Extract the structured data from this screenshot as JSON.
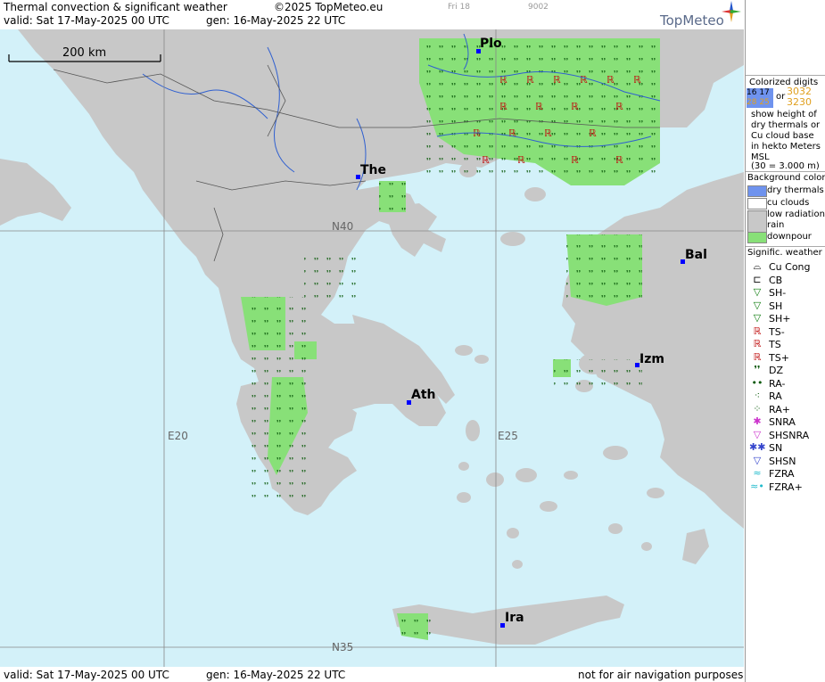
{
  "header": {
    "title": "Thermal convection & significant weather",
    "copyright": "©2025 TopMeteo.eu",
    "valid": "valid:  Sat  17-May-2025  00 UTC",
    "gen": "gen: 16-May-2025 22 UTC",
    "day_tab": "Fri 18",
    "code": "9002",
    "logo": "TopMeteo"
  },
  "scale": {
    "label": "200 km"
  },
  "cities": [
    {
      "name": "Plo"
    },
    {
      "name": "The"
    },
    {
      "name": "Bal"
    },
    {
      "name": "Izm"
    },
    {
      "name": "Ath"
    },
    {
      "name": "Ira"
    }
  ],
  "grid_labels": {
    "n40": "N40",
    "n35": "N35",
    "e20": "E20",
    "e25": "E25"
  },
  "footer": {
    "valid": "valid:  Sat  17-May-2025  00 UTC",
    "gen": "gen: 16-May-2025 22 UTC",
    "disclaimer": "not for air navigation purposes"
  },
  "legend": {
    "colorized_title": "Colorized digits",
    "sample_a_top": "16 17",
    "sample_a_bottom": "28 25",
    "or": "or",
    "sample_b_top": "3032",
    "sample_b_bottom": "3230",
    "desc1": "show height of",
    "desc2": "dry thermals or",
    "desc3": "Cu cloud base",
    "desc4": "in hekto Meters",
    "desc5": "MSL",
    "desc6": "(30 = 3.000 m)",
    "bg_title": "Background color",
    "bg_items": [
      {
        "label": "dry thermals",
        "color": "#6f93ee"
      },
      {
        "label": "cu clouds",
        "color": "#ffffff"
      },
      {
        "label": "low radiation",
        "color": "#c8c8c8"
      },
      {
        "label": "rain",
        "color": "#c8c8c8"
      },
      {
        "label": "downpour",
        "color": "#88e078"
      }
    ],
    "wx_title": "Signific. weather",
    "wx_items": [
      {
        "label": "Cu Cong",
        "icon": "cu-cong-icon",
        "glyph": "⌓",
        "color": "#000000"
      },
      {
        "label": "CB",
        "icon": "cb-icon",
        "glyph": "⊏",
        "color": "#000000"
      },
      {
        "label": "SH-",
        "icon": "shower-light-icon",
        "glyph": "▽",
        "color": "#0a7a0a"
      },
      {
        "label": "SH",
        "icon": "shower-icon",
        "glyph": "▽",
        "color": "#0a7a0a"
      },
      {
        "label": "SH+",
        "icon": "shower-heavy-icon",
        "glyph": "▽",
        "color": "#0a7a0a"
      },
      {
        "label": "TS-",
        "icon": "thunderstorm-light-icon",
        "glyph": "ℝ",
        "color": "#c01010"
      },
      {
        "label": "TS",
        "icon": "thunderstorm-icon",
        "glyph": "ℝ",
        "color": "#c01010"
      },
      {
        "label": "TS+",
        "icon": "thunderstorm-heavy-icon",
        "glyph": "ℝ",
        "color": "#c01010"
      },
      {
        "label": "DZ",
        "icon": "drizzle-icon",
        "glyph": "❜❜",
        "color": "#0a5a0a"
      },
      {
        "label": "RA-",
        "icon": "rain-light-icon",
        "glyph": "••",
        "color": "#0a5a0a"
      },
      {
        "label": "RA",
        "icon": "rain-icon",
        "glyph": "⁖",
        "color": "#0a5a0a"
      },
      {
        "label": "RA+",
        "icon": "rain-heavy-icon",
        "glyph": "⁘",
        "color": "#0a5a0a"
      },
      {
        "label": "SNRA",
        "icon": "snow-rain-icon",
        "glyph": "✱",
        "color": "#cc33cc"
      },
      {
        "label": "SHSNRA",
        "icon": "shower-snow-rain-icon",
        "glyph": "▽",
        "color": "#cc33cc"
      },
      {
        "label": "SN",
        "icon": "snow-icon",
        "glyph": "✱✱",
        "color": "#3344cc"
      },
      {
        "label": "SHSN",
        "icon": "shower-snow-icon",
        "glyph": "▽",
        "color": "#3344cc"
      },
      {
        "label": "FZRA",
        "icon": "freezing-rain-icon",
        "glyph": "≈",
        "color": "#22bbcc"
      },
      {
        "label": "FZRA+",
        "icon": "freezing-rain-heavy-icon",
        "glyph": "≈•",
        "color": "#22bbcc"
      }
    ]
  },
  "colors": {
    "sea": "#d3f1f9",
    "land": "#c8c8c8",
    "downpour": "#88e078",
    "grid": "#888888",
    "rivers": "#3060d0"
  }
}
